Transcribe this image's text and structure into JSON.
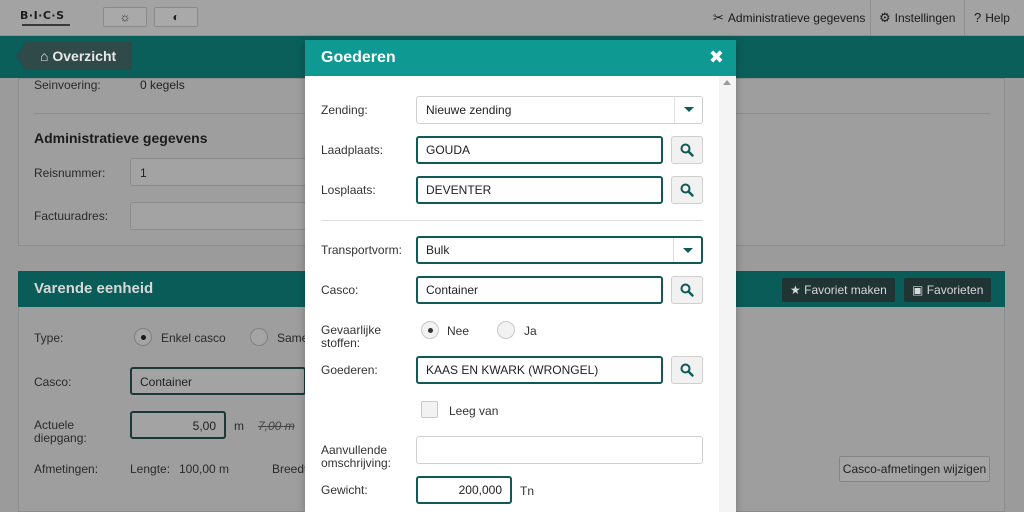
{
  "topbar": {
    "logo_text": "B·I·C·S",
    "nav": [
      {
        "icon": "wrench-screwdriver-icon",
        "label": "Administratieve gegevens"
      },
      {
        "icon": "gears-icon",
        "label": "Instellingen"
      },
      {
        "icon": "help-icon",
        "label": "Help"
      }
    ]
  },
  "back_button": {
    "label": "Overzicht",
    "icon": "home-icon"
  },
  "background": {
    "seinvoering_label": "Seinvoering:",
    "seinvoering_value": "0 kegels",
    "admin_title": "Administratieve gegevens",
    "reisnummer_label": "Reisnummer:",
    "reisnummer_value": "1",
    "factuuradres_label": "Factuuradres:",
    "varende_title": "Varende eenheid",
    "fav_make": "Favoriet maken",
    "favorites": "Favorieten",
    "type_label": "Type:",
    "type_opt1": "Enkel casco",
    "type_opt2": "Same",
    "casco_label": "Casco:",
    "casco_value": "Container",
    "diepgang_label": "Actuele diepgang:",
    "diepgang_value": "5,00",
    "diepgang_unit": "m",
    "diepgang_max": "7,00 m",
    "afmetingen_label": "Afmetingen:",
    "lengte_label": "Lengte:",
    "lengte_value": "100,00 m",
    "breedte_label": "Breedt",
    "afmetingen_button": "Casco-afmetingen wijzigen"
  },
  "modal": {
    "title": "Goederen",
    "zending_label": "Zending:",
    "zending_value": "Nieuwe zending",
    "laadplaats_label": "Laadplaats:",
    "laadplaats_value": "GOUDA",
    "losplaats_label": "Losplaats:",
    "losplaats_value": "DEVENTER",
    "transportvorm_label": "Transportvorm:",
    "transportvorm_value": "Bulk",
    "casco_label": "Casco:",
    "casco_value": "Container",
    "gevaarlijk_label": "Gevaarlijke stoffen:",
    "gevaarlijk_nee": "Nee",
    "gevaarlijk_ja": "Ja",
    "goederen_label": "Goederen:",
    "goederen_value": "KAAS EN KWARK (WRONGEL)",
    "leeg_van": "Leeg van",
    "aanvullende_label": "Aanvullende omschrijving:",
    "aanvullende_value": "",
    "gewicht_label": "Gewicht:",
    "gewicht_value": "200,000",
    "gewicht_unit": "Tn"
  }
}
